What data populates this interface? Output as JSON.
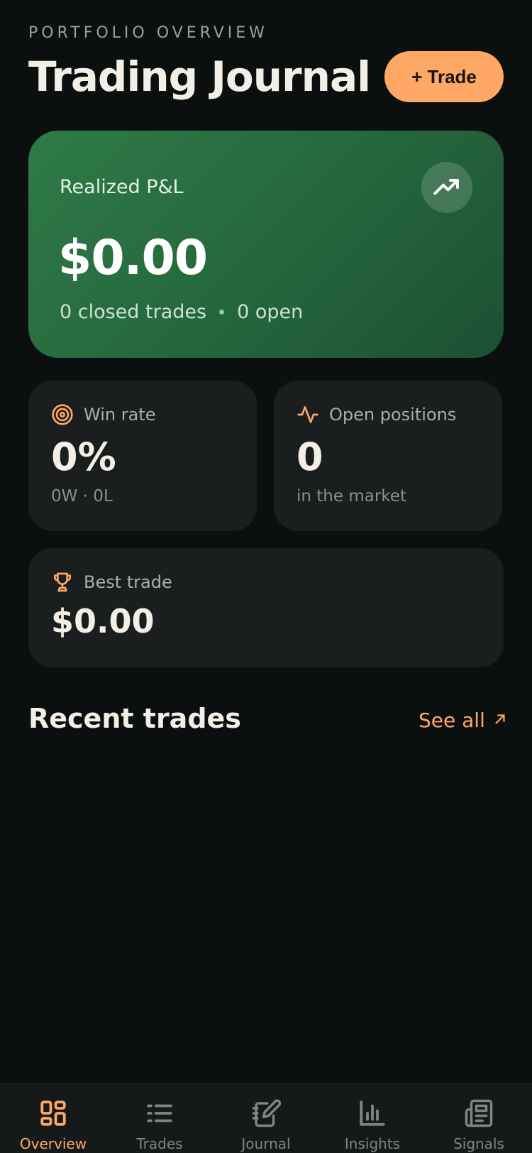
{
  "header": {
    "eyebrow": "PORTFOLIO OVERVIEW",
    "title": "Trading Journal",
    "trade_button": "+ Trade"
  },
  "pnl": {
    "label": "Realized P&L",
    "value": "$0.00",
    "closed": "0 closed trades",
    "open": "0 open",
    "icon": "trending-up-icon"
  },
  "stats": {
    "win_rate": {
      "label": "Win rate",
      "value": "0%",
      "sub": "0W · 0L",
      "icon": "target-icon"
    },
    "open_positions": {
      "label": "Open positions",
      "value": "0",
      "sub": "in the market",
      "icon": "activity-icon"
    },
    "best_trade": {
      "label": "Best trade",
      "value": "$0.00",
      "icon": "trophy-icon"
    }
  },
  "recent": {
    "title": "Recent trades",
    "see_all": "See all"
  },
  "nav": {
    "items": [
      {
        "label": "Overview",
        "icon": "grid-icon",
        "active": true
      },
      {
        "label": "Trades",
        "icon": "list-icon",
        "active": false
      },
      {
        "label": "Journal",
        "icon": "notebook-pen-icon",
        "active": false
      },
      {
        "label": "Insights",
        "icon": "bar-chart-icon",
        "active": false
      },
      {
        "label": "Signals",
        "icon": "newspaper-icon",
        "active": false
      }
    ]
  },
  "colors": {
    "accent": "#ffa865",
    "background": "#0c0f0f",
    "card": "#1a1e1e",
    "pnl_green": "#2f7a48"
  }
}
